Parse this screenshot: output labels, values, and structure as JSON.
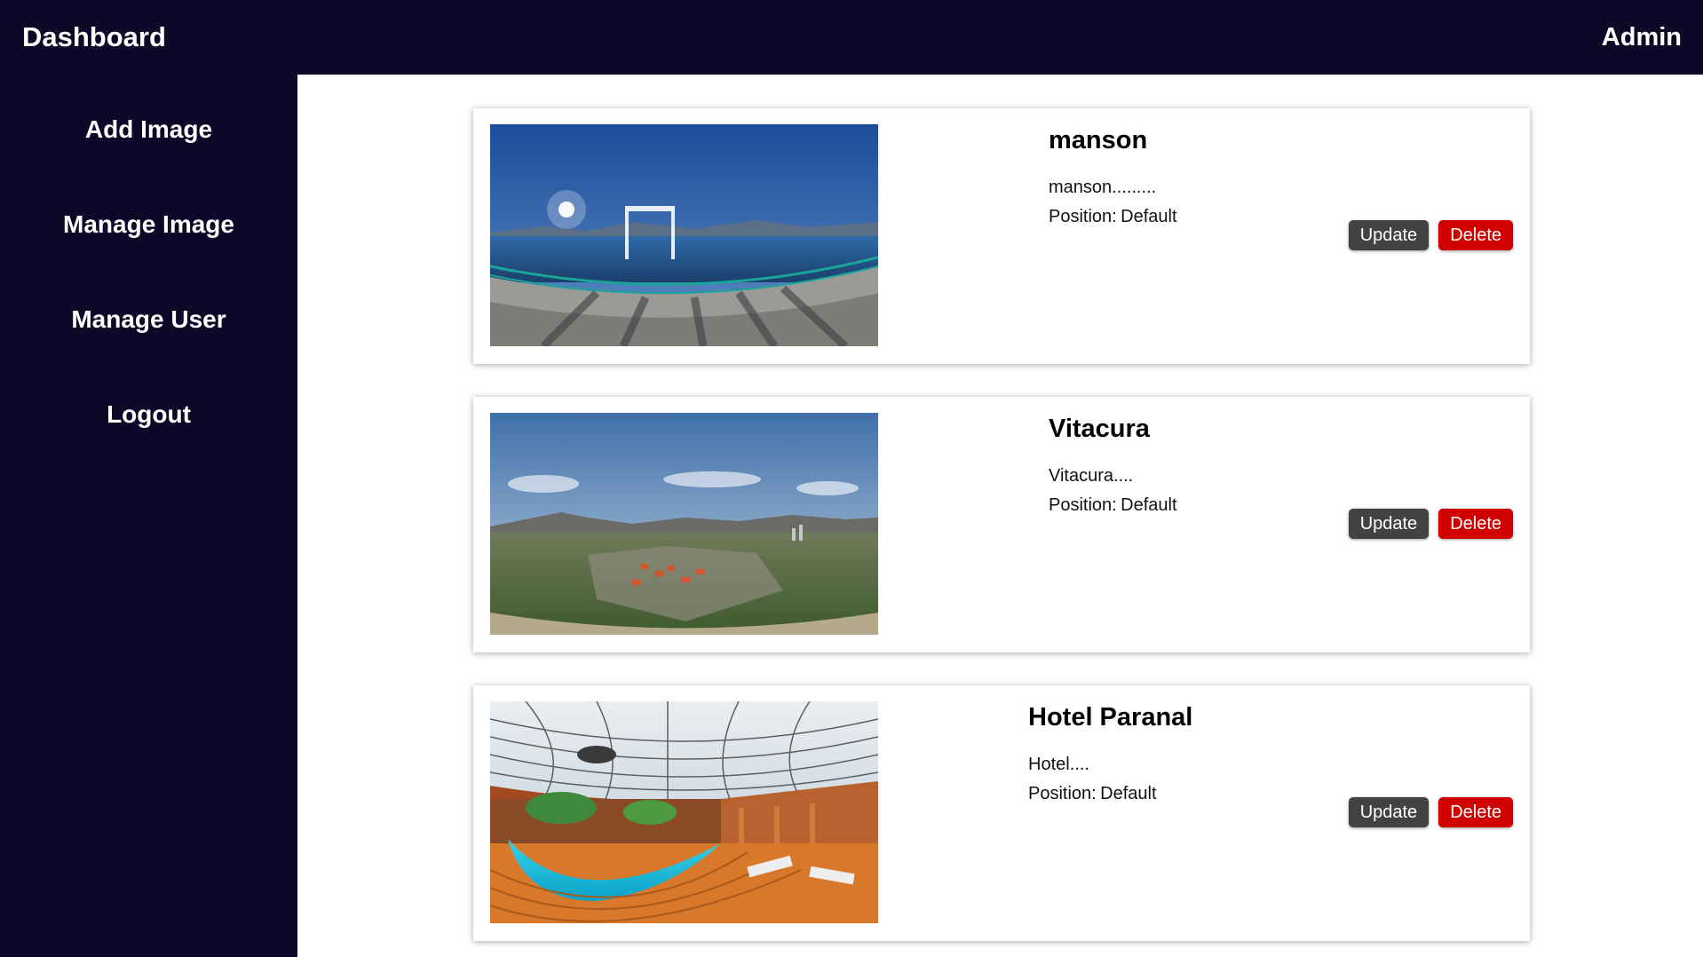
{
  "header": {
    "title": "Dashboard",
    "user": "Admin"
  },
  "sidebar": {
    "items": [
      {
        "label": "Add Image"
      },
      {
        "label": "Manage Image"
      },
      {
        "label": "Manage User"
      },
      {
        "label": "Logout"
      }
    ]
  },
  "images": [
    {
      "title": "manson",
      "description": "manson.........",
      "position_label": "Position:",
      "position": "Default",
      "update_label": "Update",
      "delete_label": "Delete"
    },
    {
      "title": "Vitacura",
      "description": "Vitacura....",
      "position_label": "Position:",
      "position": "Default",
      "update_label": "Update",
      "delete_label": "Delete"
    },
    {
      "title": "Hotel Paranal",
      "description": "Hotel....",
      "position_label": "Position:",
      "position": "Default",
      "update_label": "Update",
      "delete_label": "Delete"
    }
  ],
  "colors": {
    "nav_background": "#0e0828",
    "update_button": "#424242",
    "delete_button": "#d10000"
  }
}
